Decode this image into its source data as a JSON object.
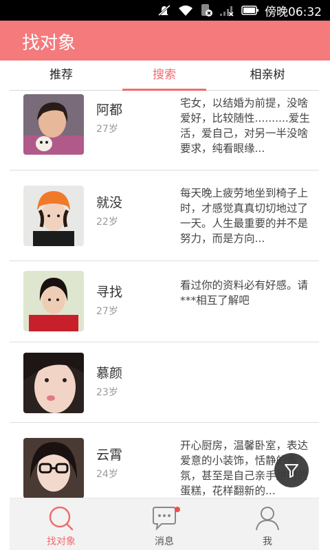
{
  "statusbar": {
    "time": "傍晚06:32",
    "icons": [
      "mute-icon",
      "wifi-icon",
      "sim-icon",
      "signal-icon",
      "battery-icon"
    ]
  },
  "appbar": {
    "title": "找对象"
  },
  "tabs": [
    {
      "label": "推荐",
      "active": false
    },
    {
      "label": "搜索",
      "active": true
    },
    {
      "label": "相亲树",
      "active": false
    }
  ],
  "list": [
    {
      "name": "阿都",
      "age": "27岁",
      "desc": "宅女，以结婚为前提，没啥爱好，比较随性..........爱生活，爱自己，对另一半没啥要求，纯看眼缘..."
    },
    {
      "name": "就没",
      "age": "22岁",
      "desc": "每天晚上疲劳地坐到椅子上时，才感觉真真切切地过了一天。人生最重要的并不是努力，而是方向..."
    },
    {
      "name": "寻找",
      "age": "27岁",
      "desc": "看过你的资料必有好感。请***相互了解吧"
    },
    {
      "name": "慕颜",
      "age": "23岁",
      "desc": ""
    },
    {
      "name": "云霄",
      "age": "24岁",
      "desc": "开心厨房，温馨卧室，表达爱意的小装饰，恬静的香氛，甚至是自己亲手烘烤的蛋糕，花样翻新的..."
    }
  ],
  "bottomnav": [
    {
      "label": "找对象",
      "active": true,
      "icon": "search-icon"
    },
    {
      "label": "消息",
      "active": false,
      "icon": "chat-icon"
    },
    {
      "label": "我",
      "active": false,
      "icon": "user-icon"
    }
  ],
  "colors": {
    "accent": "#f47a7c",
    "accent_text": "#f06b6e",
    "badge": "#f24d4d"
  }
}
